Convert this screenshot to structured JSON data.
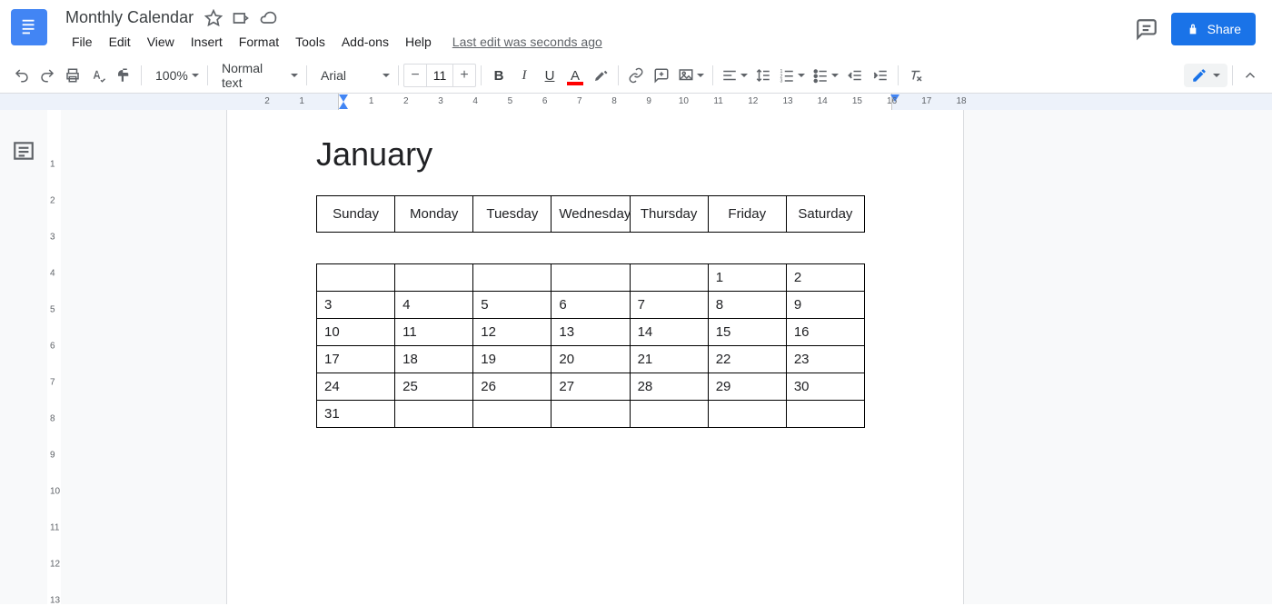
{
  "doc_title": "Monthly Calendar",
  "menus": [
    "File",
    "Edit",
    "View",
    "Insert",
    "Format",
    "Tools",
    "Add-ons",
    "Help"
  ],
  "last_edit": "Last edit was seconds ago",
  "share_label": "Share",
  "toolbar": {
    "zoom": "100%",
    "styles": "Normal text",
    "font": "Arial",
    "font_size": "11"
  },
  "ruler_h": [
    "2",
    "1",
    "",
    "1",
    "2",
    "3",
    "4",
    "5",
    "6",
    "7",
    "8",
    "9",
    "10",
    "11",
    "12",
    "13",
    "14",
    "15",
    "16",
    "17",
    "18"
  ],
  "ruler_v": [
    "",
    "1",
    "2",
    "3",
    "4",
    "5",
    "6",
    "7",
    "8",
    "9",
    "10",
    "11",
    "12",
    "13"
  ],
  "document": {
    "month": "January",
    "days": [
      "Sunday",
      "Monday",
      "Tuesday",
      "Wednesday",
      "Thursday",
      "Friday",
      "Saturday"
    ],
    "grid": [
      [
        "",
        "",
        "",
        "",
        "",
        "1",
        "2"
      ],
      [
        "3",
        "4",
        "5",
        "6",
        "7",
        "8",
        "9"
      ],
      [
        "10",
        "11",
        "12",
        "13",
        "14",
        "15",
        "16"
      ],
      [
        "17",
        "18",
        "19",
        "20",
        "21",
        "22",
        "23"
      ],
      [
        "24",
        "25",
        "26",
        "27",
        "28",
        "29",
        "30"
      ],
      [
        "31",
        "",
        "",
        "",
        "",
        "",
        ""
      ]
    ]
  }
}
